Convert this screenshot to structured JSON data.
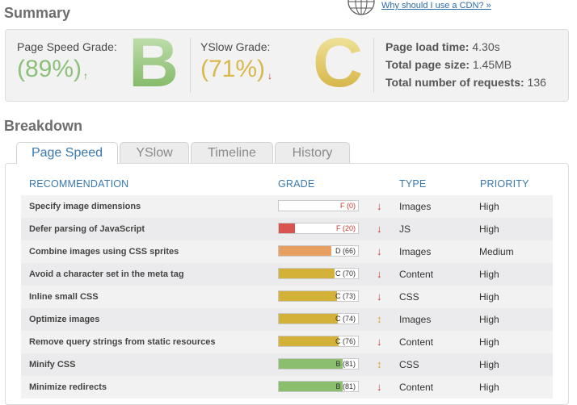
{
  "summary": {
    "title": "Summary",
    "cdn_link": "Why should I use a CDN? »",
    "pagespeed": {
      "label": "Page Speed Grade:",
      "percent": "(89%)",
      "arrow": "↑",
      "letter": "B"
    },
    "yslow": {
      "label": "YSlow Grade:",
      "percent": "(71%)",
      "arrow": "↓",
      "letter": "C"
    },
    "metrics": [
      {
        "label": "Page load time:",
        "value": "4.30s"
      },
      {
        "label": "Total page size:",
        "value": "1.45MB"
      },
      {
        "label": "Total number of requests:",
        "value": "136"
      }
    ]
  },
  "breakdown": {
    "title": "Breakdown",
    "tabs": [
      "Page Speed",
      "YSlow",
      "Timeline",
      "History"
    ],
    "columns": [
      "RECOMMENDATION",
      "GRADE",
      "TYPE",
      "PRIORITY"
    ],
    "rows": [
      {
        "rec": "Specify image dimensions",
        "grade": "F (0)",
        "score": 0,
        "color": "#d9534f",
        "trend": "↓",
        "trend_color": "#cc3333",
        "type": "Images",
        "priority": "High"
      },
      {
        "rec": "Defer parsing of JavaScript",
        "grade": "F (20)",
        "score": 20,
        "color": "#d9534f",
        "trend": "↓",
        "trend_color": "#cc3333",
        "type": "JS",
        "priority": "High"
      },
      {
        "rec": "Combine images using CSS sprites",
        "grade": "D (66)",
        "score": 66,
        "color": "#e8a060",
        "trend": "↓",
        "trend_color": "#cc3333",
        "type": "Images",
        "priority": "Medium"
      },
      {
        "rec": "Avoid a character set in the meta tag",
        "grade": "C (70)",
        "score": 70,
        "color": "#d4b23a",
        "trend": "↓",
        "trend_color": "#cc3333",
        "type": "Content",
        "priority": "High"
      },
      {
        "rec": "Inline small CSS",
        "grade": "C (73)",
        "score": 73,
        "color": "#d4b23a",
        "trend": "↓",
        "trend_color": "#cc3333",
        "type": "CSS",
        "priority": "High"
      },
      {
        "rec": "Optimize images",
        "grade": "C (74)",
        "score": 74,
        "color": "#d4b23a",
        "trend": "↕",
        "trend_color": "#e0a040",
        "type": "Images",
        "priority": "High"
      },
      {
        "rec": "Remove query strings from static resources",
        "grade": "C (76)",
        "score": 76,
        "color": "#d4b23a",
        "trend": "↓",
        "trend_color": "#cc3333",
        "type": "Content",
        "priority": "High"
      },
      {
        "rec": "Minify CSS",
        "grade": "B (81)",
        "score": 81,
        "color": "#8bbf6e",
        "trend": "↕",
        "trend_color": "#e0a040",
        "type": "CSS",
        "priority": "High"
      },
      {
        "rec": "Minimize redirects",
        "grade": "B (81)",
        "score": 81,
        "color": "#8bbf6e",
        "trend": "↓",
        "trend_color": "#cc3333",
        "type": "Content",
        "priority": "High"
      }
    ]
  },
  "colors": {
    "pagespeed_green": "#8dc07a",
    "yslow_gold": "#d8b84a",
    "link_blue": "#2b6aa8",
    "header_blue": "#3a78b0"
  }
}
